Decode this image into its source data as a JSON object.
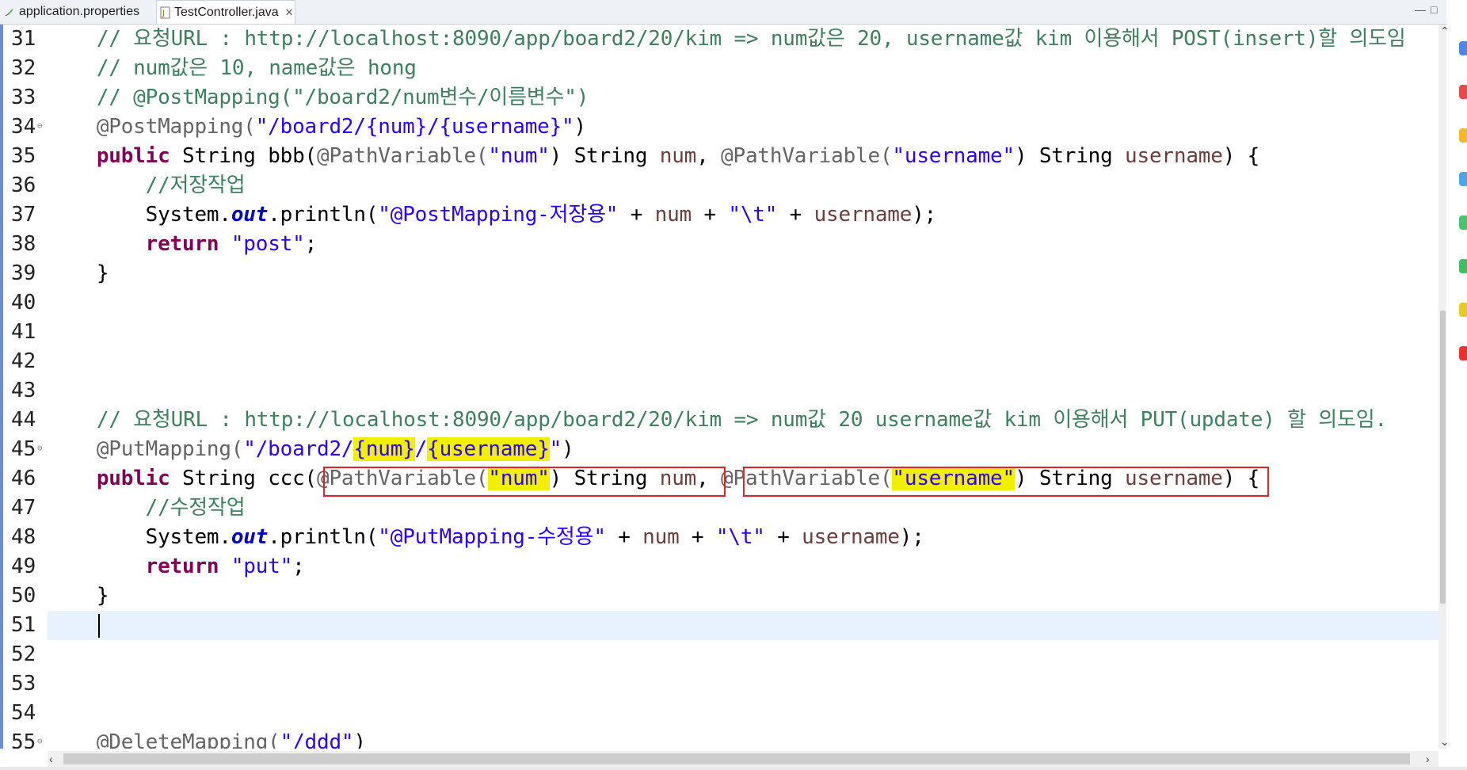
{
  "tabs": [
    {
      "label": "application.properties",
      "icon": "properties-file-icon"
    },
    {
      "label": "TestController.java",
      "icon": "java-file-icon",
      "close": "✕"
    }
  ],
  "window_controls": {
    "minimize": "—",
    "maximize": "□"
  },
  "lines": [
    {
      "n": "31",
      "fold": "",
      "current": false,
      "segs": [
        {
          "t": "    // 요청URL : http://localhost:8090/app/board2/20/kim => num값은 20, username값 kim 이용해서 POST(insert)할 의도임",
          "c": "cm"
        }
      ]
    },
    {
      "n": "32",
      "fold": "",
      "current": false,
      "segs": [
        {
          "t": "    // num값은 10, name값은 hong",
          "c": "cm"
        }
      ]
    },
    {
      "n": "33",
      "fold": "",
      "current": false,
      "segs": [
        {
          "t": "    // @PostMapping(\"/board2/num변수/이름변수\")",
          "c": "cm"
        }
      ]
    },
    {
      "n": "34",
      "fold": "⊖",
      "current": false,
      "segs": [
        {
          "t": "    @PostMapping(",
          "c": "an"
        },
        {
          "t": "\"/board2/{num}/{username}\"",
          "c": "st"
        },
        {
          "t": ")",
          "c": ""
        }
      ]
    },
    {
      "n": "35",
      "fold": "",
      "current": false,
      "segs": [
        {
          "t": "    ",
          "c": ""
        },
        {
          "t": "public",
          "c": "kw"
        },
        {
          "t": " String bbb(",
          "c": ""
        },
        {
          "t": "@PathVariable(",
          "c": "an"
        },
        {
          "t": "\"num\"",
          "c": "st"
        },
        {
          "t": ") String ",
          "c": ""
        },
        {
          "t": "num",
          "c": "vr"
        },
        {
          "t": ", ",
          "c": ""
        },
        {
          "t": "@PathVariable(",
          "c": "an"
        },
        {
          "t": "\"username\"",
          "c": "st"
        },
        {
          "t": ") String ",
          "c": ""
        },
        {
          "t": "username",
          "c": "vr"
        },
        {
          "t": ") {",
          "c": ""
        }
      ]
    },
    {
      "n": "36",
      "fold": "",
      "current": false,
      "segs": [
        {
          "t": "        //저장작업",
          "c": "cm"
        }
      ]
    },
    {
      "n": "37",
      "fold": "",
      "current": false,
      "segs": [
        {
          "t": "        System.",
          "c": ""
        },
        {
          "t": "out",
          "c": "fd"
        },
        {
          "t": ".println(",
          "c": ""
        },
        {
          "t": "\"@PostMapping-저장용\"",
          "c": "st"
        },
        {
          "t": " + ",
          "c": ""
        },
        {
          "t": "num",
          "c": "vr"
        },
        {
          "t": " + ",
          "c": ""
        },
        {
          "t": "\"\\t\"",
          "c": "st"
        },
        {
          "t": " + ",
          "c": ""
        },
        {
          "t": "username",
          "c": "vr"
        },
        {
          "t": ");",
          "c": ""
        }
      ]
    },
    {
      "n": "38",
      "fold": "",
      "current": false,
      "segs": [
        {
          "t": "        ",
          "c": ""
        },
        {
          "t": "return",
          "c": "kw"
        },
        {
          "t": " ",
          "c": ""
        },
        {
          "t": "\"post\"",
          "c": "st"
        },
        {
          "t": ";",
          "c": ""
        }
      ]
    },
    {
      "n": "39",
      "fold": "",
      "current": false,
      "segs": [
        {
          "t": "    }",
          "c": ""
        }
      ]
    },
    {
      "n": "40",
      "fold": "",
      "current": false,
      "segs": []
    },
    {
      "n": "41",
      "fold": "",
      "current": false,
      "segs": []
    },
    {
      "n": "42",
      "fold": "",
      "current": false,
      "segs": []
    },
    {
      "n": "43",
      "fold": "",
      "current": false,
      "segs": []
    },
    {
      "n": "44",
      "fold": "",
      "current": false,
      "segs": [
        {
          "t": "    // 요청URL : http://localhost:8090/app/board2/20/kim => num값 20 username값 kim 이용해서 PUT(update) 할 의도임.",
          "c": "cm"
        }
      ]
    },
    {
      "n": "45",
      "fold": "⊖",
      "current": false,
      "segs": [
        {
          "t": "    @PutMapping(",
          "c": "an"
        },
        {
          "t": "\"/board2/",
          "c": "st"
        },
        {
          "t": "{num}",
          "c": "st hl"
        },
        {
          "t": "/",
          "c": "st"
        },
        {
          "t": "{username}",
          "c": "st hl"
        },
        {
          "t": "\"",
          "c": "st"
        },
        {
          "t": ")",
          "c": ""
        }
      ]
    },
    {
      "n": "46",
      "fold": "",
      "current": false,
      "segs": [
        {
          "t": "    ",
          "c": ""
        },
        {
          "t": "public",
          "c": "kw"
        },
        {
          "t": " String ccc(",
          "c": ""
        },
        {
          "t": "@PathVariable(",
          "c": "an"
        },
        {
          "t": "\"num\"",
          "c": "st hl"
        },
        {
          "t": ") String ",
          "c": ""
        },
        {
          "t": "num",
          "c": "vr"
        },
        {
          "t": ", ",
          "c": ""
        },
        {
          "t": "@PathVariable(",
          "c": "an"
        },
        {
          "t": "\"username\"",
          "c": "st hl"
        },
        {
          "t": ") String ",
          "c": ""
        },
        {
          "t": "username",
          "c": "vr"
        },
        {
          "t": ") {",
          "c": ""
        }
      ]
    },
    {
      "n": "47",
      "fold": "",
      "current": false,
      "segs": [
        {
          "t": "        //수정작업",
          "c": "cm"
        }
      ]
    },
    {
      "n": "48",
      "fold": "",
      "current": false,
      "segs": [
        {
          "t": "        System.",
          "c": ""
        },
        {
          "t": "out",
          "c": "fd"
        },
        {
          "t": ".println(",
          "c": ""
        },
        {
          "t": "\"@PutMapping-수정용\"",
          "c": "st"
        },
        {
          "t": " + ",
          "c": ""
        },
        {
          "t": "num",
          "c": "vr"
        },
        {
          "t": " + ",
          "c": ""
        },
        {
          "t": "\"\\t\"",
          "c": "st"
        },
        {
          "t": " + ",
          "c": ""
        },
        {
          "t": "username",
          "c": "vr"
        },
        {
          "t": ");",
          "c": ""
        }
      ]
    },
    {
      "n": "49",
      "fold": "",
      "current": false,
      "segs": [
        {
          "t": "        ",
          "c": ""
        },
        {
          "t": "return",
          "c": "kw"
        },
        {
          "t": " ",
          "c": ""
        },
        {
          "t": "\"put\"",
          "c": "st"
        },
        {
          "t": ";",
          "c": ""
        }
      ]
    },
    {
      "n": "50",
      "fold": "",
      "current": false,
      "segs": [
        {
          "t": "    }",
          "c": ""
        }
      ]
    },
    {
      "n": "51",
      "fold": "",
      "current": true,
      "segs": []
    },
    {
      "n": "52",
      "fold": "",
      "current": false,
      "segs": []
    },
    {
      "n": "53",
      "fold": "",
      "current": false,
      "segs": []
    },
    {
      "n": "54",
      "fold": "",
      "current": false,
      "segs": []
    },
    {
      "n": "55",
      "fold": "⊖",
      "current": false,
      "segs": [
        {
          "t": "    @DeleteMapping(",
          "c": "an"
        },
        {
          "t": "\"/ddd\"",
          "c": "st"
        },
        {
          "t": ")",
          "c": ""
        }
      ]
    }
  ],
  "colors": {
    "comment": "#3f7f5f",
    "keyword": "#7f0055",
    "annotation": "#646464",
    "string": "#2a00ff",
    "field": "#0000c0",
    "highlight": "#f0f000",
    "annotation_box": "#e0202a"
  },
  "side_dock_colors": [
    "#4f86e8",
    "#e84a4a",
    "#f2b92b",
    "#4aa6e8",
    "#4ac46a",
    "#3fbf62",
    "#e8c92b",
    "#e83232"
  ]
}
